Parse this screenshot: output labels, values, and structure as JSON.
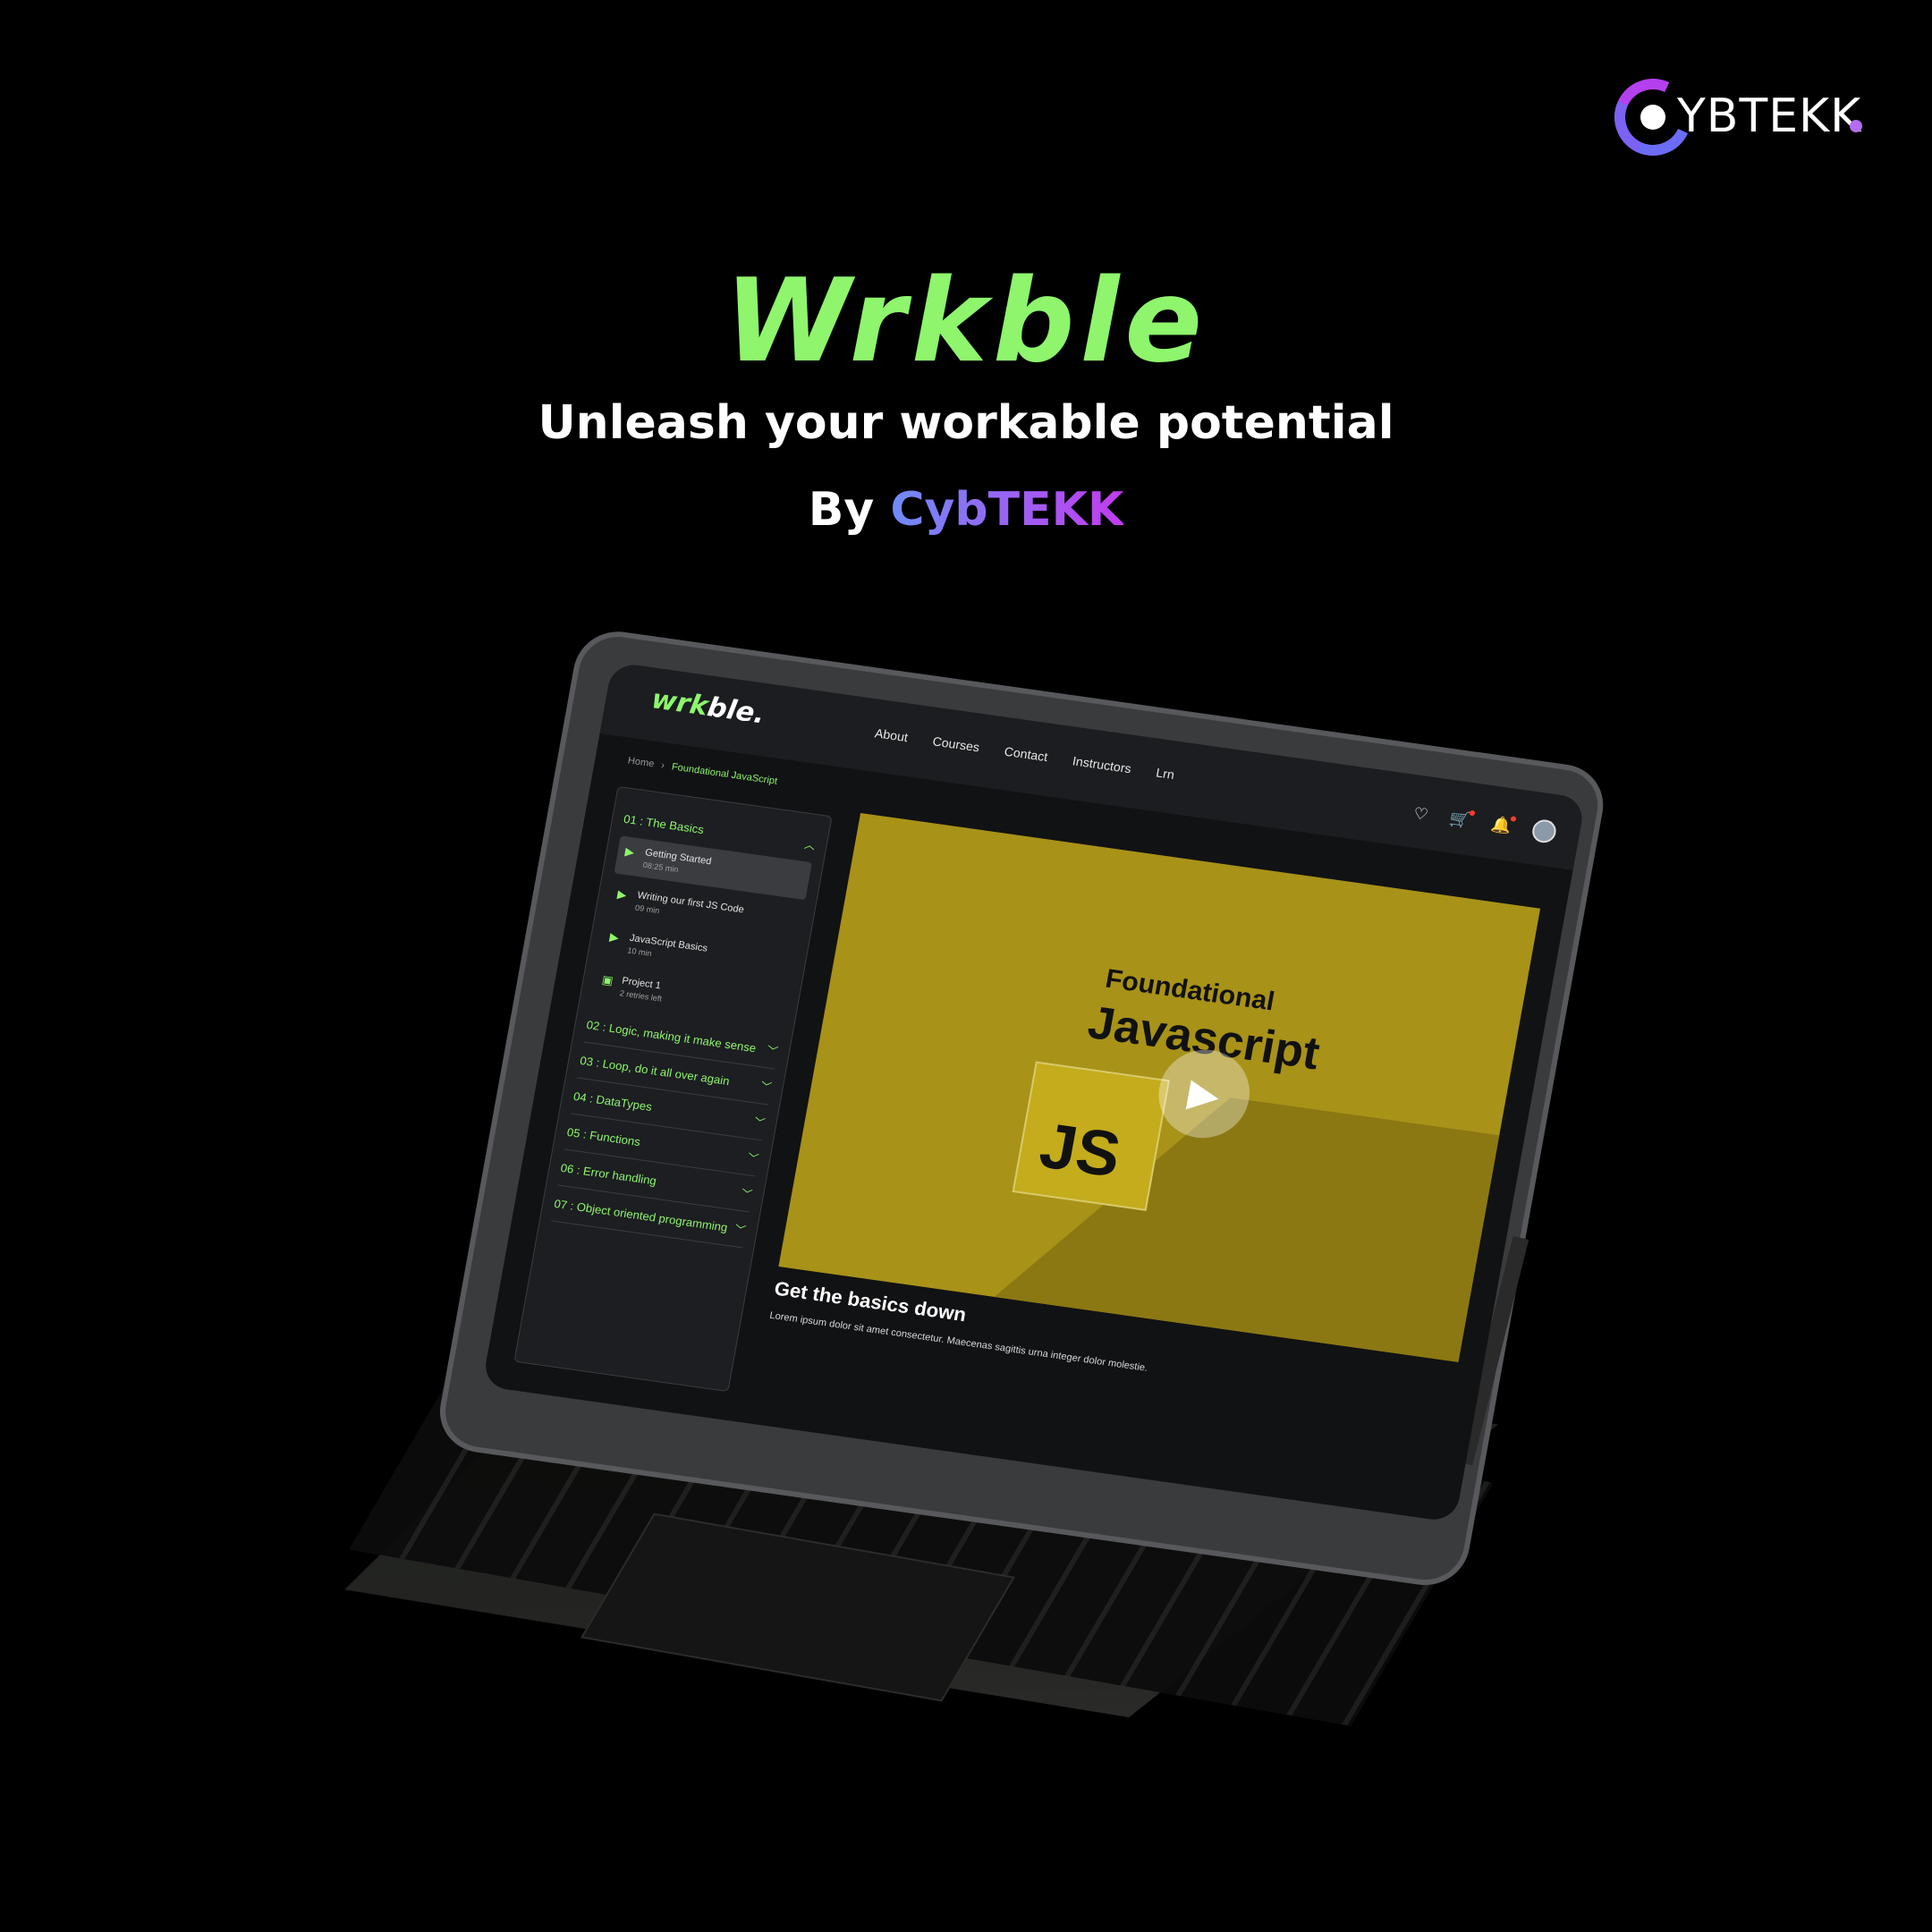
{
  "brand": {
    "logo_text": "YBTEKK",
    "logo_text_prefix": "C"
  },
  "hero": {
    "title": "Wrkble",
    "subtitle": "Unleash your workable potential",
    "by_prefix": "By",
    "by_brand": "CybTEKK"
  },
  "app": {
    "logo_w": "wrk",
    "logo_rest": "ble.",
    "nav": [
      "About",
      "Courses",
      "Contact",
      "Instructors",
      "Lrn"
    ],
    "icons": {
      "wishlist": "♡",
      "cart": "🛒",
      "bell": "🔔"
    }
  },
  "breadcrumb": {
    "home": "Home",
    "sep": "›",
    "current": "Foundational JavaScript"
  },
  "sidebar": {
    "open_section": "01 : The Basics",
    "lessons": [
      {
        "title": "Getting Started",
        "meta": "08:25 min",
        "icon": "▶"
      },
      {
        "title": "Writing our first JS Code",
        "meta": "09 min",
        "icon": "▶"
      },
      {
        "title": "JavaScript Basics",
        "meta": "10 min",
        "icon": "▶"
      },
      {
        "title": "Project 1",
        "meta": "2 retries left",
        "icon": "▣"
      }
    ],
    "sections": [
      "02 : Logic, making it make sense",
      "03 : Loop, do it all over again",
      "04 : DataTypes",
      "05 : Functions",
      "06 : Error handling",
      "07 : Object oriented programming"
    ]
  },
  "video": {
    "title_line1": "Foundational",
    "title_line2": "Javascript",
    "badge": "JS",
    "play": "▶"
  },
  "lesson_info": {
    "title": "Get the basics down",
    "description": "Lorem ipsum dolor sit amet consectetur. Maecenas sagittis urna integer dolor molestie."
  }
}
